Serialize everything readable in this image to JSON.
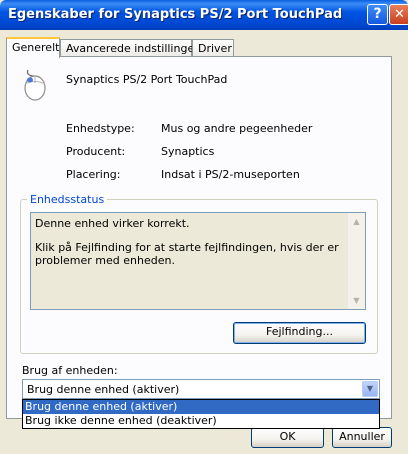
{
  "window": {
    "title": "Egenskaber for Synaptics PS/2 Port TouchPad",
    "help_button": "?",
    "close_button": "✕"
  },
  "tabs": [
    {
      "label": "Generelt",
      "active": true
    },
    {
      "label": "Avancerede indstillinger",
      "active": false
    },
    {
      "label": "Driver",
      "active": false
    }
  ],
  "device": {
    "icon": "mouse-icon",
    "name": "Synaptics PS/2 Port TouchPad",
    "properties": [
      {
        "label": "Enhedstype:",
        "value": "Mus og andre pegeenheder"
      },
      {
        "label": "Producent:",
        "value": "Synaptics"
      },
      {
        "label": "Placering:",
        "value": "Indsat i PS/2-museporten"
      }
    ]
  },
  "status": {
    "group_title": "Enhedsstatus",
    "line1": "Denne enhed virker korrekt.",
    "line2": "Klik på Fejlfinding for at starte fejlfindingen, hvis der er problemer med enheden.",
    "troubleshoot_button": "Fejlfinding..."
  },
  "usage": {
    "label": "Brug af enheden:",
    "selected": "Brug denne enhed (aktiver)",
    "options": [
      "Brug denne enhed (aktiver)",
      "Brug ikke denne enhed (deaktiver)"
    ]
  },
  "buttons": {
    "ok": "OK",
    "cancel": "Annuller"
  },
  "colors": {
    "titlebar": "#0054E3",
    "selection": "#316AC5",
    "dialog_bg": "#ECE9D8",
    "group_title": "#0046D5"
  }
}
